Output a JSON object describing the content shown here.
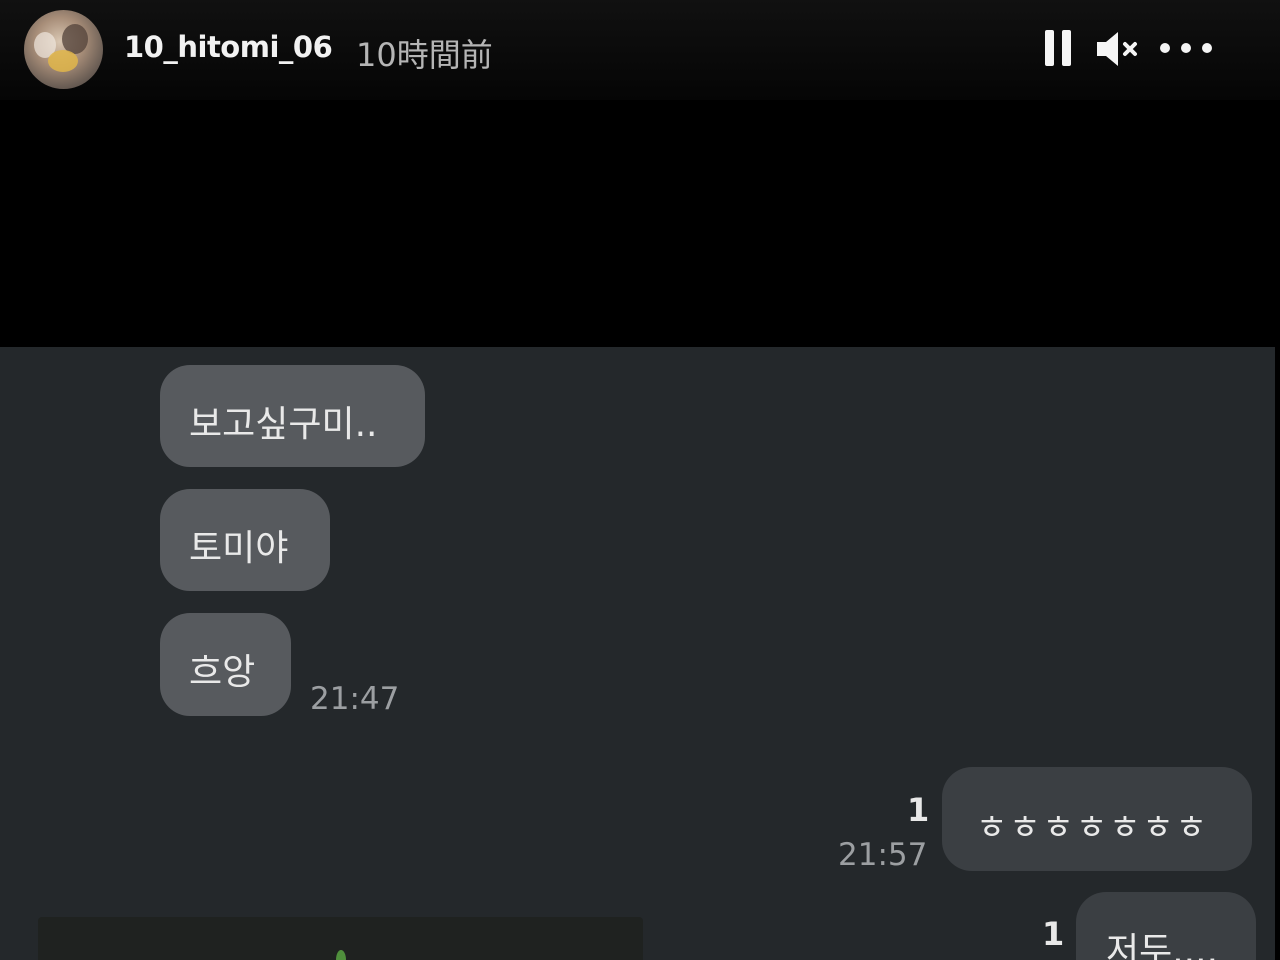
{
  "header": {
    "username": "10_hitomi_06",
    "timestamp": "10時間前",
    "icons": {
      "avatar": "profile-avatar",
      "pause": "pause-icon",
      "mute": "speaker-muted-icon",
      "more": "more-options-icon"
    }
  },
  "chat": {
    "received": [
      {
        "text": "보고싶구미.."
      },
      {
        "text": "토미야"
      },
      {
        "text": "흐앙"
      }
    ],
    "received_time": "21:47",
    "sent": [
      {
        "text": "ㅎㅎㅎㅎㅎㅎㅎ",
        "read_count": "1",
        "time": "21:57"
      },
      {
        "text": "저두....",
        "read_count": "1"
      }
    ]
  },
  "colors": {
    "header_bg": "#000000",
    "chat_bg": "#24282b",
    "received_bubble": "#575a5e",
    "sent_bubble": "#3b3f43",
    "time_text": "#9c9fa2"
  }
}
